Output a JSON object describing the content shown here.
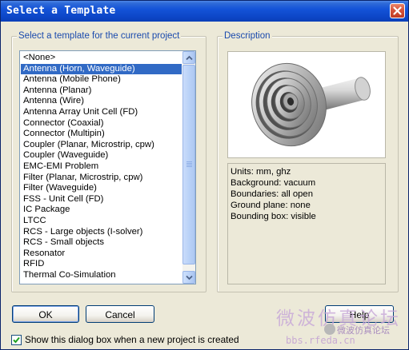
{
  "window": {
    "title": "Select a Template"
  },
  "template_group": {
    "label": "Select a template for the current project",
    "items": [
      "<None>",
      "Antenna (Horn, Waveguide)",
      "Antenna (Mobile Phone)",
      "Antenna (Planar)",
      "Antenna (Wire)",
      "Antenna Array Unit Cell (FD)",
      "Connector (Coaxial)",
      "Connector (Multipin)",
      "Coupler (Planar, Microstrip, cpw)",
      "Coupler (Waveguide)",
      "EMC-EMI Problem",
      "Filter (Planar, Microstrip, cpw)",
      "Filter (Waveguide)",
      "FSS - Unit Cell (FD)",
      "IC Package",
      "LTCC",
      "RCS - Large objects (I-solver)",
      "RCS - Small objects",
      "Resonator",
      "RFID",
      "Thermal Co-Simulation"
    ],
    "selected_index": 1
  },
  "description_group": {
    "label": "Description",
    "preview_icon": "horn-antenna-3d-model",
    "lines": [
      "Units: mm, ghz",
      "Background: vacuum",
      "Boundaries: all open",
      "Ground plane: none",
      "Bounding box: visible"
    ]
  },
  "buttons": {
    "ok": "OK",
    "cancel": "Cancel",
    "help": "Help"
  },
  "show_dialog_checkbox": {
    "label": "Show this dialog box when a new project is created",
    "checked": true
  },
  "watermark": {
    "title": "微波仿真论坛",
    "subtitle": "微波仿真论坛",
    "url": "bbs.rfeda.cn"
  },
  "colors": {
    "titlebar": "#0d47c8",
    "selection": "#316ac5",
    "group_label": "#1a4aad",
    "dialog_bg": "#ece9d8"
  }
}
